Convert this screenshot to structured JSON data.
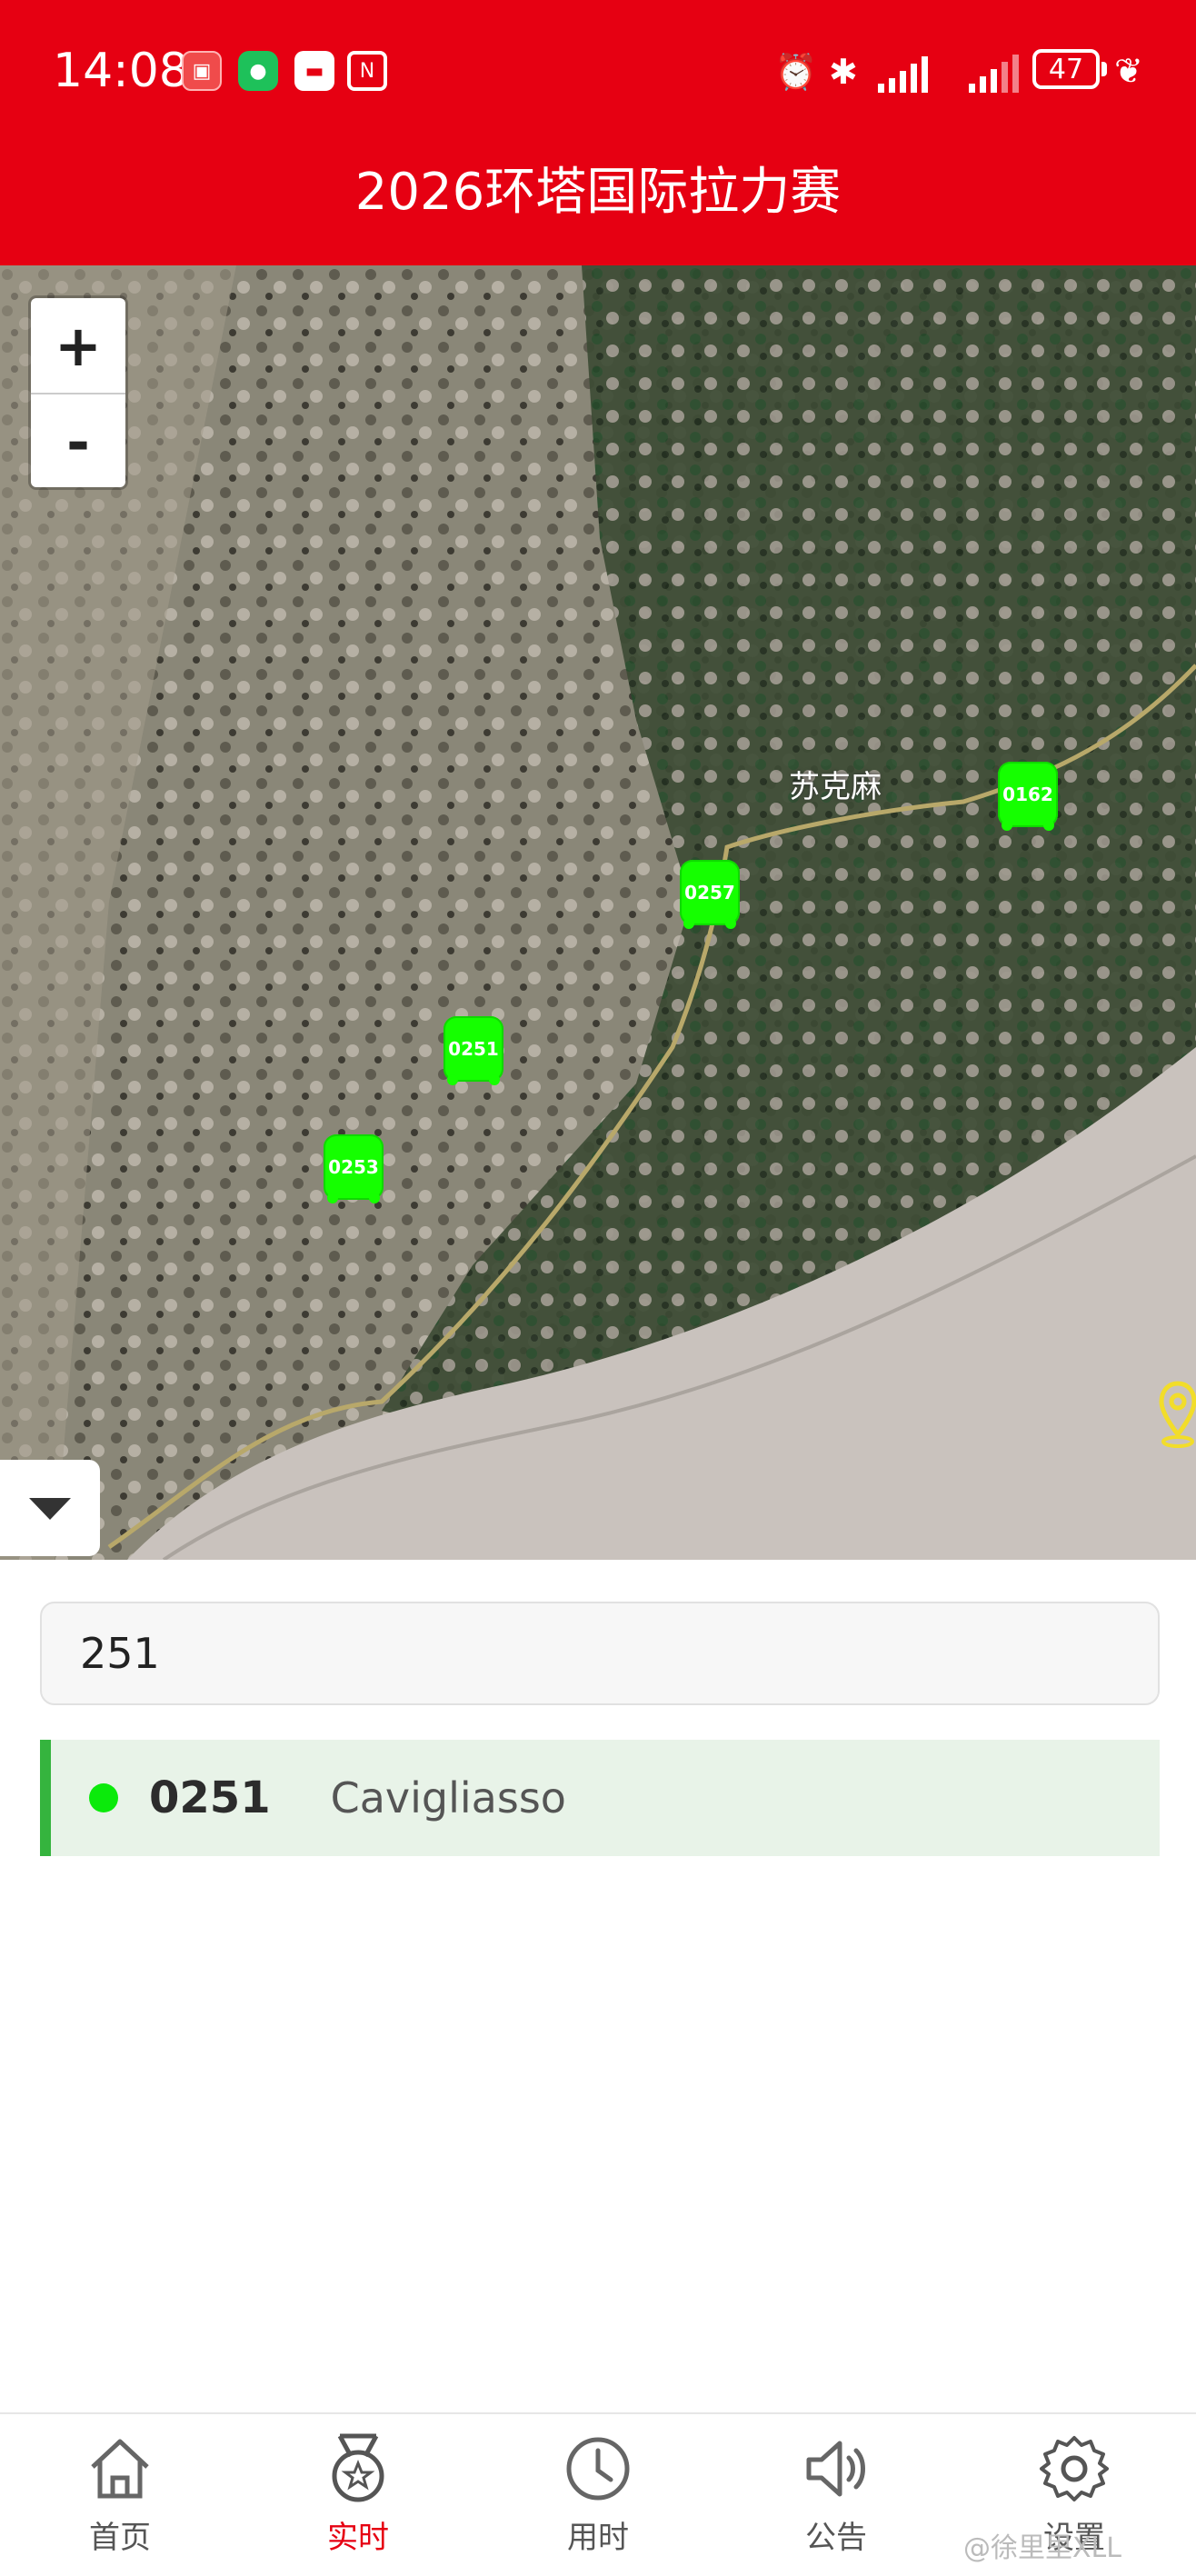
{
  "status_bar": {
    "time": "14:08",
    "battery": "47",
    "notification_icons": [
      "huawei-store-icon",
      "wechat-icon",
      "box-icon",
      "nfc-icon"
    ],
    "right_icons": [
      "alarm-icon",
      "bluetooth-icon",
      "signal-icon",
      "signal-icon",
      "battery-icon",
      "leaf-icon"
    ]
  },
  "header": {
    "title": "2026环塔国际拉力赛",
    "background": "#e60012"
  },
  "map": {
    "zoom_in": "+",
    "zoom_out": "-",
    "place_label": "苏克麻",
    "markers": [
      {
        "id": "0162"
      },
      {
        "id": "0257"
      },
      {
        "id": "0251"
      },
      {
        "id": "0253"
      }
    ],
    "marker_color": "#15ff00"
  },
  "search": {
    "value": "251"
  },
  "results": [
    {
      "number": "0251",
      "name": "Cavigliasso",
      "status_color": "#0bea0b"
    }
  ],
  "nav": {
    "items": [
      {
        "label": "首页",
        "icon": "home-icon",
        "active": false
      },
      {
        "label": "实时",
        "icon": "medal-icon",
        "active": true
      },
      {
        "label": "用时",
        "icon": "clock-icon",
        "active": false
      },
      {
        "label": "公告",
        "icon": "speaker-icon",
        "active": false
      },
      {
        "label": "设置",
        "icon": "gear-icon",
        "active": false
      }
    ],
    "active_color": "#e60012"
  },
  "watermark": "@徐里里XLL"
}
